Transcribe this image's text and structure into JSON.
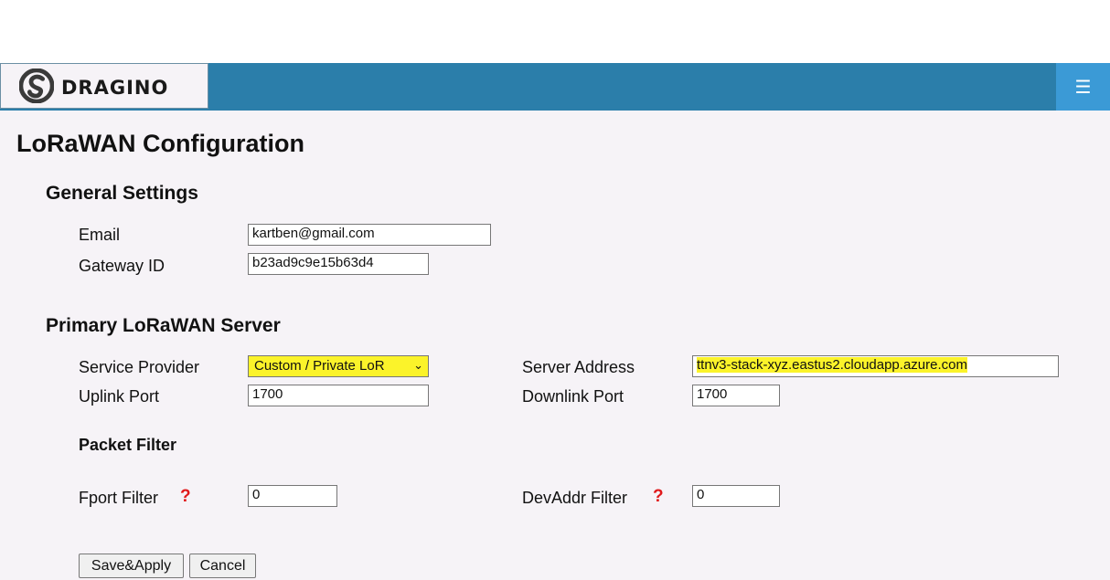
{
  "header": {
    "logo_text": "DRAGINO",
    "menu_icon": "☰",
    "menu_icon_name": "hamburger-menu-icon"
  },
  "page": {
    "title": "LoRaWAN Configuration"
  },
  "general": {
    "heading": "General Settings",
    "email_label": "Email",
    "email_value": "kartben@gmail.com",
    "gateway_label": "Gateway ID",
    "gateway_value": "b23ad9c9e15b63d4"
  },
  "primary": {
    "heading": "Primary LoRaWAN Server",
    "provider_label": "Service Provider",
    "provider_value": "Custom / Private LoR",
    "server_label": "Server Address",
    "server_value": "ttnv3-stack-xyz.eastus2.cloudapp.azure.com",
    "uplink_label": "Uplink Port",
    "uplink_value": "1700",
    "downlink_label": "Downlink Port",
    "downlink_value": "1700"
  },
  "filter": {
    "heading": "Packet Filter",
    "fport_label": "Fport Filter",
    "fport_value": "0",
    "devaddr_label": "DevAddr Filter",
    "devaddr_value": "0",
    "help_glyph": "?"
  },
  "actions": {
    "save_label": "Save&Apply",
    "cancel_label": "Cancel"
  },
  "colors": {
    "topbar": "#2b7eaa",
    "menu_button": "#3b9ad6",
    "highlight": "#fbf32a",
    "help": "#e0191b",
    "background": "#f6f3f7"
  }
}
